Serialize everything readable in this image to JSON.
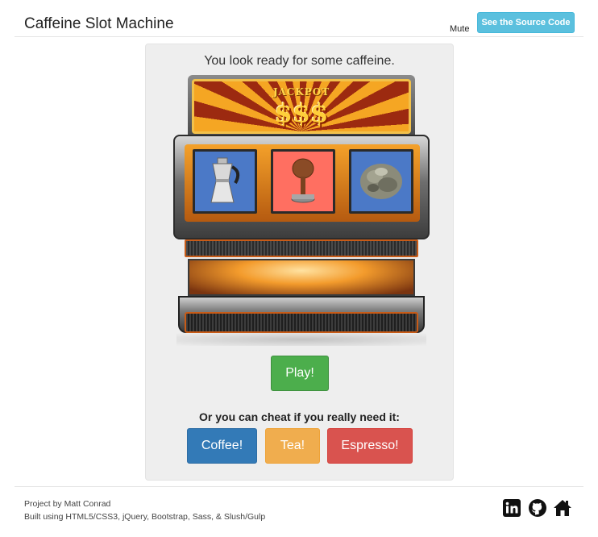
{
  "header": {
    "title": "Caffeine Slot Machine",
    "mute_label": "Mute",
    "source_button_label": "See the Source Code"
  },
  "main": {
    "status_text": "You look ready for some caffeine.",
    "machine": {
      "marquee_top": "JACKPOT",
      "marquee_symbols": "$$$",
      "reels": [
        {
          "icon": "moka-pot-icon",
          "label": "Coffee",
          "color": "#4b79c7"
        },
        {
          "icon": "tamper-icon",
          "label": "Espresso",
          "color": "#ff6f61"
        },
        {
          "icon": "tea-leaves-icon",
          "label": "Tea",
          "color": "#4b79c7"
        }
      ]
    },
    "play_label": "Play!",
    "cheat_text": "Or you can cheat if you really need it:",
    "cheat_buttons": {
      "coffee": "Coffee!",
      "tea": "Tea!",
      "espresso": "Espresso!"
    }
  },
  "footer": {
    "credit": "Project by Matt Conrad",
    "built_with": "Built using HTML5/CSS3, jQuery, Bootstrap, Sass, & Slush/Gulp",
    "links": [
      "linkedin-icon",
      "github-icon",
      "home-icon"
    ]
  },
  "colors": {
    "info": "#5bc0de",
    "success": "#4cae4c",
    "primary": "#337ab7",
    "warning": "#f0ad4e",
    "danger": "#d9534f"
  }
}
